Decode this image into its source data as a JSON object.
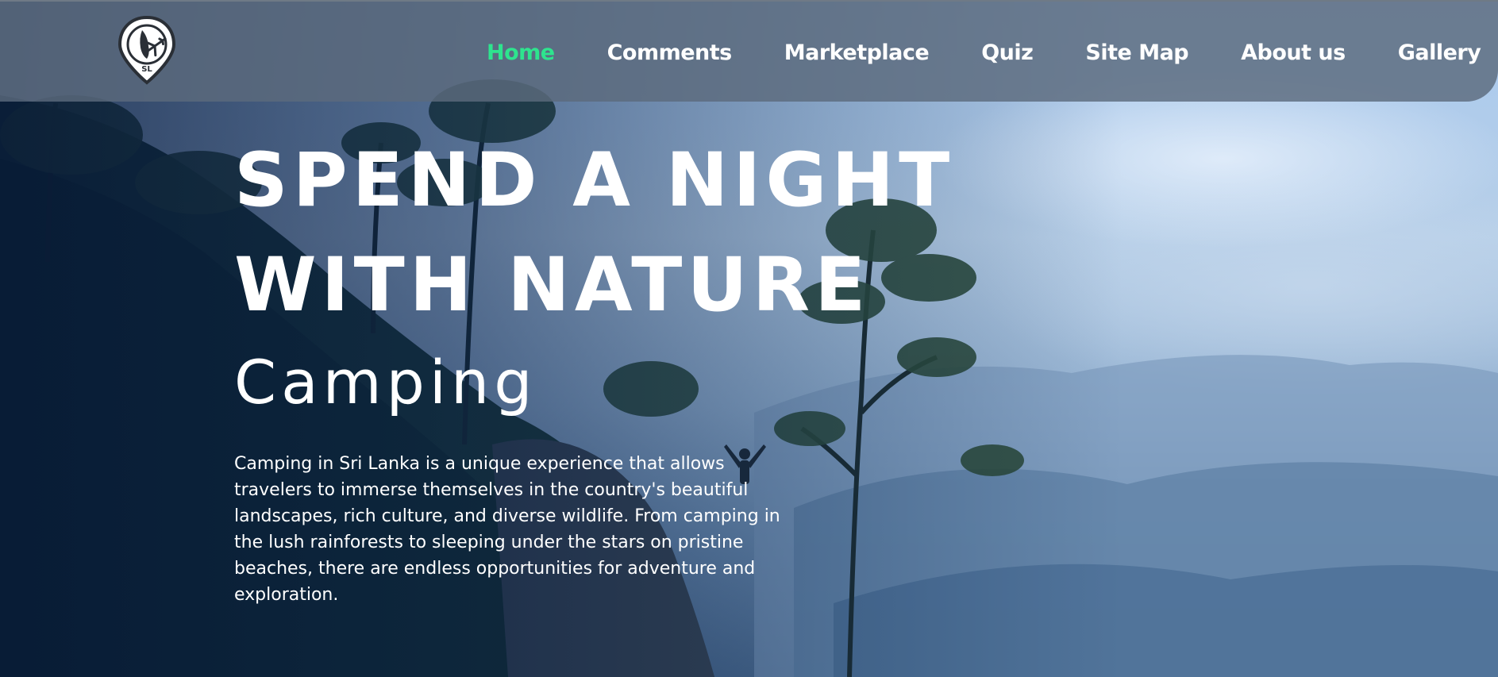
{
  "nav": {
    "logo_text": "SL",
    "items": [
      {
        "label": "Home",
        "active": true
      },
      {
        "label": "Comments",
        "active": false
      },
      {
        "label": "Marketplace",
        "active": false
      },
      {
        "label": "Quiz",
        "active": false
      },
      {
        "label": "Site Map",
        "active": false
      },
      {
        "label": "About us",
        "active": false
      },
      {
        "label": "Gallery",
        "active": false
      }
    ]
  },
  "hero": {
    "title_line1": "SPEND A NIGHT",
    "title_line2": "WITH NATURE",
    "subtitle": "Camping",
    "description": "Camping in Sri Lanka is a unique experience that allows travelers to immerse themselves in the country's beautiful landscapes, rich culture, and diverse wildlife. From camping in the lush rainforests to sleeping under the stars on pristine beaches, there are endless opportunities for adventure and exploration."
  },
  "colors": {
    "active_nav": "#2ee48e",
    "navbar_bg": "#5c6a7c",
    "text": "#ffffff"
  },
  "icons": {
    "logo": "map-pin-airplane-icon"
  }
}
